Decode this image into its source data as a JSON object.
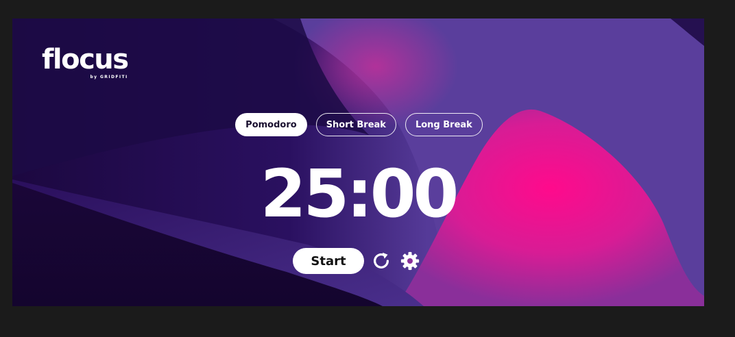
{
  "brand": {
    "name": "flocus",
    "byline": "by GRIDFITI"
  },
  "modes": [
    {
      "label": "Pomodoro",
      "active": true
    },
    {
      "label": "Short Break",
      "active": false
    },
    {
      "label": "Long Break",
      "active": false
    }
  ],
  "timer": {
    "display": "25:00"
  },
  "controls": {
    "start_label": "Start",
    "reset_icon": "refresh-icon",
    "settings_icon": "gear-icon"
  },
  "colors": {
    "page_background": "#1b1b1b",
    "deep_purple": "#1e0a44",
    "violet": "#5a3f9a",
    "magenta": "#f0108a",
    "text": "#ffffff"
  }
}
